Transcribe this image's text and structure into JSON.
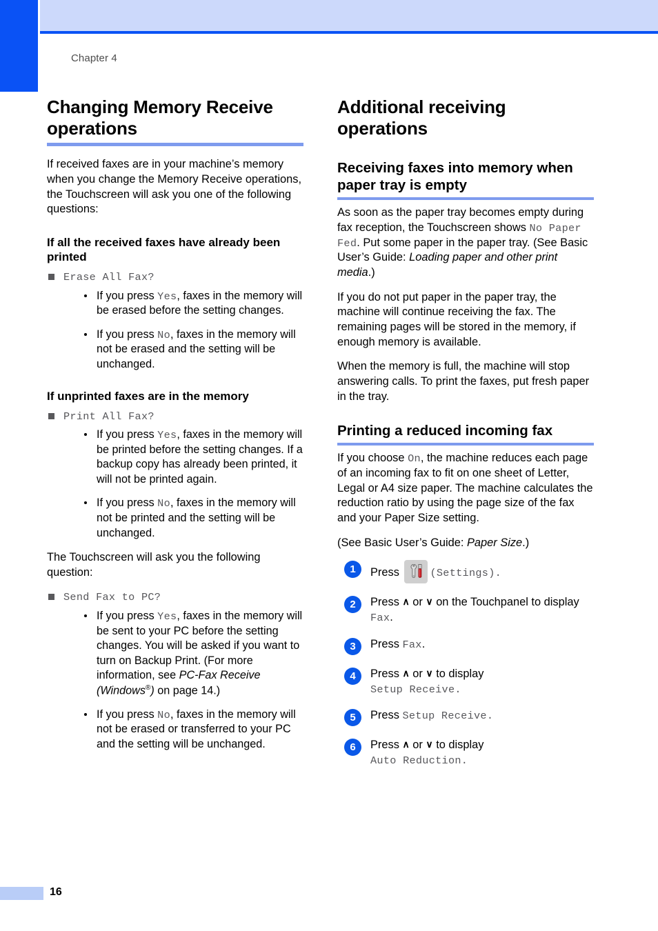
{
  "page": {
    "chapter_label": "Chapter 4",
    "page_number": "16",
    "accent_blue": "#0a52f5",
    "band_blue": "#ccd9fb",
    "rule_blue": "#7e9bee",
    "step_circle_blue": "#0a58e8"
  },
  "left_column": {
    "heading": "Changing Memory Receive operations",
    "intro": "If received faxes are in your machine’s memory when you change the Memory Receive operations, the Touchscreen will ask you one of the following questions:",
    "sections": [
      {
        "title": "If all the received faxes have already been printed",
        "prompt": "Erase All Fax?",
        "bullets": [
          {
            "pre": "If you press ",
            "key": "Yes",
            "post": ", faxes in the memory will be erased before the setting changes."
          },
          {
            "pre": "If you press ",
            "key": "No",
            "post": ", faxes in the memory will not be erased and the setting will be unchanged."
          }
        ]
      },
      {
        "title": "If unprinted faxes are in the memory",
        "prompt": "Print All Fax?",
        "bullets": [
          {
            "pre": "If you press ",
            "key": "Yes",
            "post": ", faxes in the memory will be printed before the setting changes. If a backup copy has already been printed, it will not be printed again."
          },
          {
            "pre": "If you press ",
            "key": "No",
            "post": ", faxes in the memory will not be printed and the setting will be unchanged."
          }
        ]
      }
    ],
    "touchscreen_note": "The Touchscreen will ask you the following question:",
    "pc_prompt": "Send Fax to PC?",
    "pc_bullets": [
      {
        "pre": "If you press ",
        "key": "Yes",
        "post": ", faxes in the memory will be sent to your PC before the setting changes. You will be asked if you want to turn on Backup Print. (For more information, see ",
        "italic_ref": "PC-Fax Receive (Windows",
        "italic_ref_sup": "®",
        "italic_ref_tail": ")",
        "post2": " on page 14.)"
      },
      {
        "pre": "If you press ",
        "key": "No",
        "post": ", faxes in the memory will not be erased or transferred to your PC and the setting will be unchanged."
      }
    ]
  },
  "right_column": {
    "heading": "Additional receiving operations",
    "section1": {
      "title": "Receiving faxes into memory when paper tray is empty",
      "p1_pre": "As soon as the paper tray becomes empty during fax reception, the Touchscreen shows ",
      "p1_mono": "No Paper Fed",
      "p1_mid": ". Put some paper in the paper tray. (See Basic User’s Guide: ",
      "p1_italic": "Loading paper and other print media",
      "p1_post": ".)",
      "p2": "If you do not put paper in the paper tray, the machine will continue receiving the fax. The remaining pages will be stored in the memory, if enough memory is available.",
      "p3": "When the memory is full, the machine will stop answering calls. To print the faxes, put fresh paper in the tray."
    },
    "section2": {
      "title": "Printing a reduced incoming fax",
      "p1_pre": "If you choose ",
      "p1_mono": "On",
      "p1_post": ", the machine reduces each page of an incoming fax to fit on one sheet of Letter, Legal or A4 size paper. The machine calculates the reduction ratio by using the page size of the fax and your Paper Size setting.",
      "p2_pre": "(See Basic User’s Guide: ",
      "p2_italic": "Paper Size",
      "p2_post": ".)",
      "steps": [
        {
          "num": "1",
          "pre": "Press ",
          "icon": "settings-icon",
          "mono_paren_open": "(",
          "mono": "Settings",
          "mono_paren_close": ").",
          "post": ""
        },
        {
          "num": "2",
          "pre": "Press ",
          "arrow_up": "∧",
          "or": " or ",
          "arrow_down": "∨",
          "mid": " on the Touchpanel to display ",
          "mono": "Fax",
          "post": "."
        },
        {
          "num": "3",
          "pre": "Press ",
          "mono": "Fax",
          "post": "."
        },
        {
          "num": "4",
          "pre": "Press ",
          "arrow_up": "∧",
          "or": " or ",
          "arrow_down": "∨",
          "mid": " to display ",
          "mono": "Setup Receive",
          "post": "."
        },
        {
          "num": "5",
          "pre": "Press ",
          "mono": "Setup Receive",
          "post": "."
        },
        {
          "num": "6",
          "pre": "Press ",
          "arrow_up": "∧",
          "or": " or ",
          "arrow_down": "∨",
          "mid": " to display ",
          "mono": "Auto Reduction",
          "post": "."
        }
      ]
    }
  }
}
